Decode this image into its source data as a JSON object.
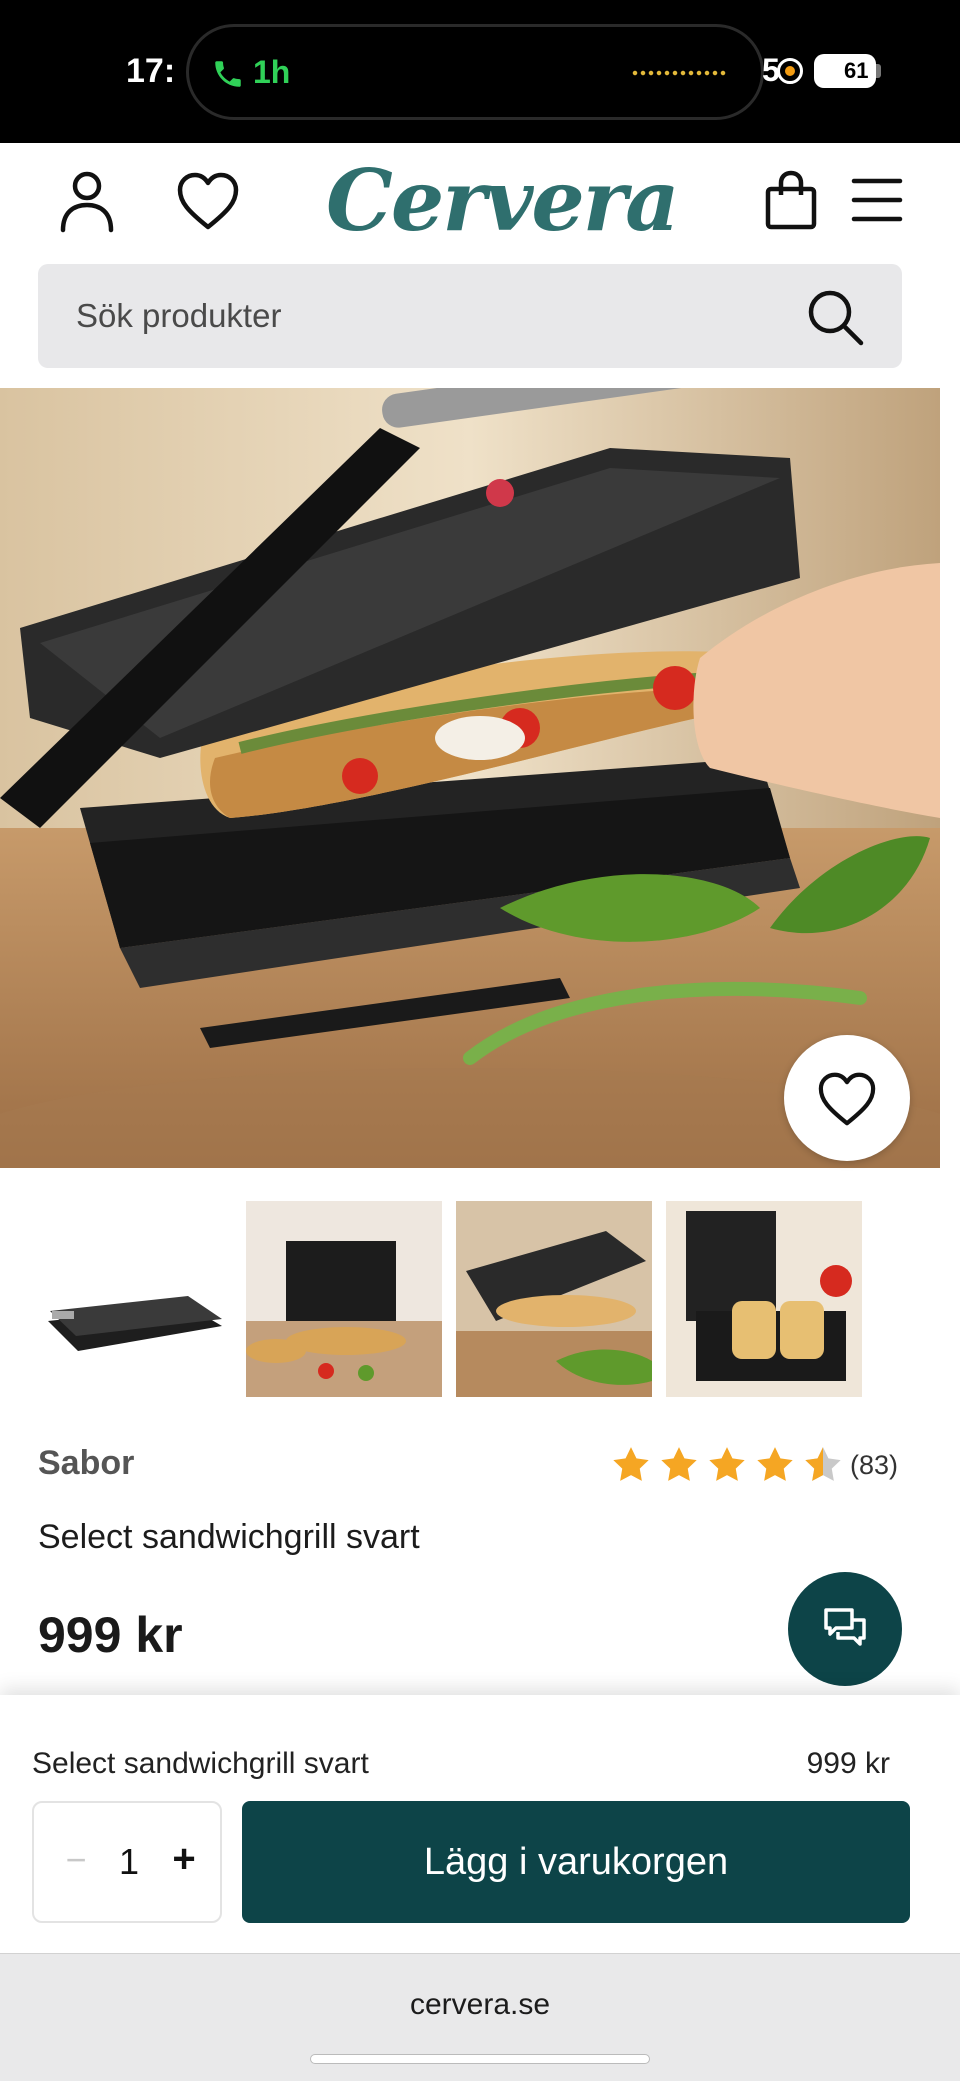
{
  "status_bar": {
    "time": "17:",
    "call_duration": "1h",
    "right_fragment": "5",
    "battery": "61"
  },
  "header": {
    "logo": "Cervera",
    "icons": [
      "account-icon",
      "wishlist-icon",
      "cart-icon",
      "menu-icon"
    ]
  },
  "search": {
    "placeholder": "Sök produkter"
  },
  "product": {
    "brand": "Sabor",
    "name": "Select sandwichgrill svart",
    "price": "999 kr",
    "rating": 4.5,
    "review_count": "(83)",
    "thumbnail_count": 4
  },
  "buy_bar": {
    "name": "Select sandwichgrill svart",
    "price": "999 kr",
    "quantity_minus": "−",
    "quantity": "1",
    "quantity_plus": "+",
    "add_to_cart": "Lägg i varukorgen"
  },
  "browser": {
    "url": "cervera.se"
  },
  "colors": {
    "brand_teal": "#2f6f6e",
    "button_dark_teal": "#0d4448",
    "star": "#f5a623",
    "call_green": "#30d158"
  }
}
